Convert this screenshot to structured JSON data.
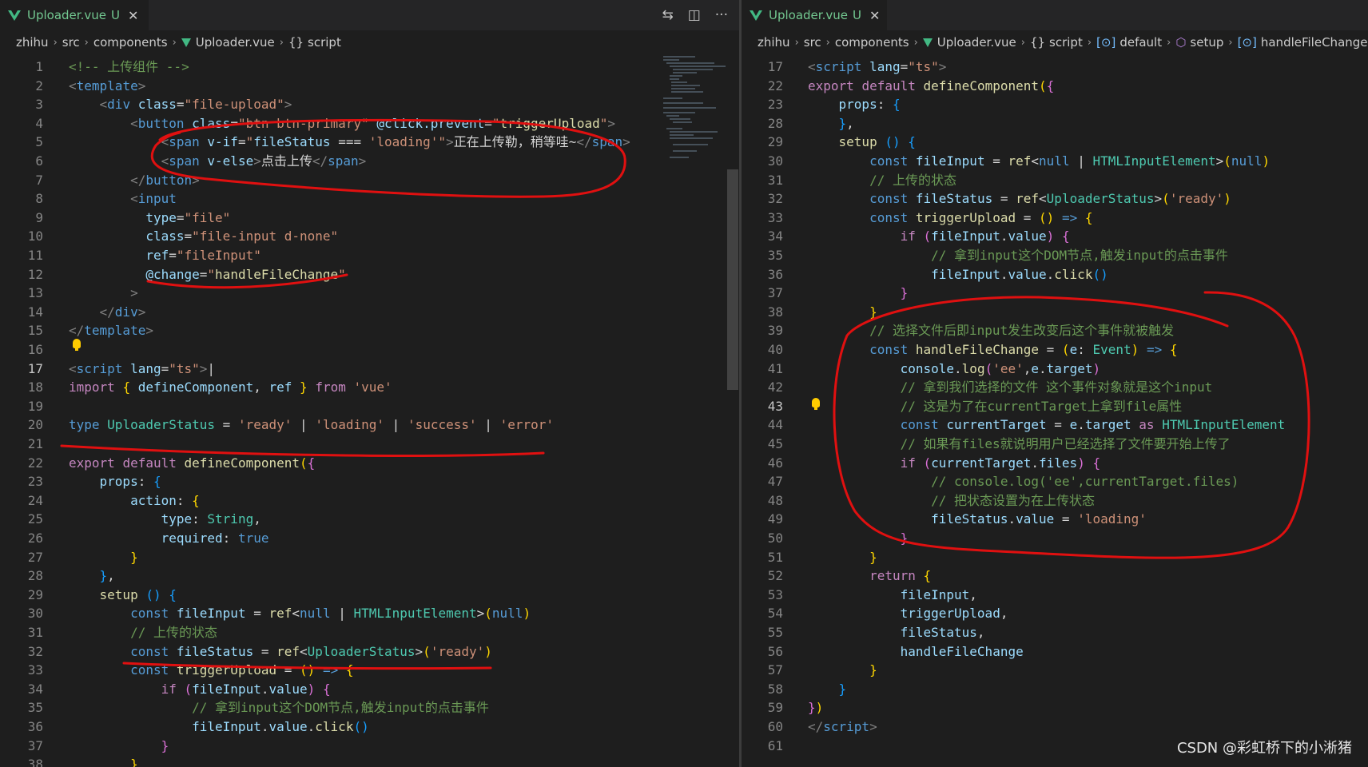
{
  "left": {
    "tab": {
      "name": "Uploader.vue",
      "modified": "U",
      "close": "✕"
    },
    "actions": [
      {
        "name": "compare-changes-icon",
        "glyph": "⇆"
      },
      {
        "name": "split-editor-icon",
        "glyph": "◫"
      },
      {
        "name": "more-actions-icon",
        "glyph": "···"
      }
    ],
    "breadcrumb": [
      {
        "label": "zhihu"
      },
      {
        "label": "src"
      },
      {
        "label": "components"
      },
      {
        "label": "Uploader.vue",
        "icon": "vue"
      },
      {
        "label": "script",
        "icon": "{}"
      }
    ],
    "lines": [
      {
        "n": "1",
        "html": "<span class='c'>&lt;!-- 上传组件 --&gt;</span>"
      },
      {
        "n": "2",
        "html": "<span class='t'>&lt;</span><span class='n'>template</span><span class='t'>&gt;</span>"
      },
      {
        "n": "3",
        "html": "    <span class='t'>&lt;</span><span class='n'>div</span> <span class='a'>class</span><span class='p'>=</span><span class='s'>\"file-upload\"</span><span class='t'>&gt;</span>"
      },
      {
        "n": "4",
        "html": "        <span class='t'>&lt;</span><span class='n'>button</span> <span class='a'>class</span><span class='p'>=</span><span class='s'>\"btn btn-primary\"</span> <span class='a'>@click.prevent</span><span class='p'>=</span><span class='s'>\"</span><span class='f'>triggerUpload</span><span class='s'>\"</span><span class='t'>&gt;</span>"
      },
      {
        "n": "5",
        "html": "            <span class='t'>&lt;</span><span class='n'>span</span> <span class='a'>v-if</span><span class='p'>=</span><span class='s'>\"</span><span class='a'>fileStatus</span> <span class='p'>===</span> <span class='s'>'loading'\"</span><span class='t'>&gt;</span><span class='p'>正在上传勒，稍等哇~</span><span class='t'>&lt;/</span><span class='n'>span</span><span class='t'>&gt;</span>"
      },
      {
        "n": "6",
        "html": "            <span class='t'>&lt;</span><span class='n'>span</span> <span class='a'>v-else</span><span class='t'>&gt;</span><span class='p'>点击上传</span><span class='t'>&lt;/</span><span class='n'>span</span><span class='t'>&gt;</span>"
      },
      {
        "n": "7",
        "html": "        <span class='t'>&lt;/</span><span class='n'>button</span><span class='t'>&gt;</span>"
      },
      {
        "n": "8",
        "html": "        <span class='t'>&lt;</span><span class='n'>input</span>"
      },
      {
        "n": "9",
        "html": "          <span class='a'>type</span><span class='p'>=</span><span class='s'>\"file\"</span>"
      },
      {
        "n": "10",
        "html": "          <span class='a'>class</span><span class='p'>=</span><span class='s'>\"file-input d-none\"</span>"
      },
      {
        "n": "11",
        "html": "          <span class='a'>ref</span><span class='p'>=</span><span class='s'>\"fileInput\"</span>"
      },
      {
        "n": "12",
        "html": "          <span class='a'>@change</span><span class='p'>=</span><span class='s'>\"</span><span class='f'>handleFileChange</span><span class='s'>\"</span>"
      },
      {
        "n": "13",
        "html": "        <span class='t'>&gt;</span>"
      },
      {
        "n": "14",
        "html": "    <span class='t'>&lt;/</span><span class='n'>div</span><span class='t'>&gt;</span>"
      },
      {
        "n": "15",
        "html": "<span class='t'>&lt;/</span><span class='n'>template</span><span class='t'>&gt;</span>"
      },
      {
        "n": "16",
        "html": ""
      },
      {
        "n": "17",
        "html": "<span class='t'>&lt;</span><span class='n'>script</span> <span class='a'>lang</span><span class='p'>=</span><span class='s'>\"ts\"</span><span class='t'>&gt;</span><span class='p'>|</span>",
        "active": true
      },
      {
        "n": "18",
        "html": "<span class='k'>import</span> <span class='b1'>{</span> <span class='a'>defineComponent</span><span class='p'>,</span> <span class='a'>ref</span> <span class='b1'>}</span> <span class='k'>from</span> <span class='s'>'vue'</span>"
      },
      {
        "n": "19",
        "html": ""
      },
      {
        "n": "20",
        "html": "<span class='n'>type</span> <span class='ty'>UploaderStatus</span> <span class='p'>=</span> <span class='s'>'ready'</span> <span class='p'>|</span> <span class='s'>'loading'</span> <span class='p'>|</span> <span class='s'>'success'</span> <span class='p'>|</span> <span class='s'>'error'</span>"
      },
      {
        "n": "21",
        "html": ""
      },
      {
        "n": "22",
        "html": "<span class='k'>export</span> <span class='k'>default</span> <span class='f'>defineComponent</span><span class='b1'>(</span><span class='b2'>{</span>"
      },
      {
        "n": "23",
        "html": "    <span class='a'>props</span><span class='p'>:</span> <span class='b3'>{</span>"
      },
      {
        "n": "24",
        "html": "        <span class='a'>action</span><span class='p'>:</span> <span class='b1'>{</span>"
      },
      {
        "n": "25",
        "html": "            <span class='a'>type</span><span class='p'>:</span> <span class='ty'>String</span><span class='p'>,</span>"
      },
      {
        "n": "26",
        "html": "            <span class='a'>required</span><span class='p'>:</span> <span class='n'>true</span>"
      },
      {
        "n": "27",
        "html": "        <span class='b1'>}</span>"
      },
      {
        "n": "28",
        "html": "    <span class='b3'>}</span><span class='p'>,</span>"
      },
      {
        "n": "29",
        "html": "    <span class='f'>setup</span> <span class='b3'>()</span> <span class='b3'>{</span>"
      },
      {
        "n": "30",
        "html": "        <span class='n'>const</span> <span class='a'>fileInput</span> <span class='p'>=</span> <span class='f'>ref</span><span class='p'>&lt;</span><span class='n'>null</span> <span class='p'>|</span> <span class='ty'>HTMLInputElement</span><span class='p'>&gt;</span><span class='b1'>(</span><span class='n'>null</span><span class='b1'>)</span>"
      },
      {
        "n": "31",
        "html": "        <span class='c'>// 上传的状态</span>"
      },
      {
        "n": "32",
        "html": "        <span class='n'>const</span> <span class='a'>fileStatus</span> <span class='p'>=</span> <span class='f'>ref</span><span class='p'>&lt;</span><span class='ty'>UploaderStatus</span><span class='p'>&gt;</span><span class='b1'>(</span><span class='s'>'ready'</span><span class='b1'>)</span>"
      },
      {
        "n": "33",
        "html": "        <span class='n'>const</span> <span class='f'>triggerUpload</span> <span class='p'>=</span> <span class='b1'>()</span> <span class='n'>=&gt;</span> <span class='b1'>{</span>"
      },
      {
        "n": "34",
        "html": "            <span class='k'>if</span> <span class='b2'>(</span><span class='a'>fileInput</span><span class='p'>.</span><span class='a'>value</span><span class='b2'>)</span> <span class='b2'>{</span>"
      },
      {
        "n": "35",
        "html": "                <span class='c'>// 拿到input这个DOM节点,触发input的点击事件</span>"
      },
      {
        "n": "36",
        "html": "                <span class='a'>fileInput</span><span class='p'>.</span><span class='a'>value</span><span class='p'>.</span><span class='f'>click</span><span class='b3'>()</span>"
      },
      {
        "n": "37",
        "html": "            <span class='b2'>}</span>"
      },
      {
        "n": "38",
        "html": "        <span class='b1'>}</span>"
      }
    ]
  },
  "right": {
    "tab": {
      "name": "Uploader.vue",
      "modified": "U",
      "close": "✕"
    },
    "breadcrumb": [
      {
        "label": "zhihu"
      },
      {
        "label": "src"
      },
      {
        "label": "components"
      },
      {
        "label": "Uploader.vue",
        "icon": "vue"
      },
      {
        "label": "script",
        "icon": "{}"
      },
      {
        "label": "default",
        "icon": "[⊙]"
      },
      {
        "label": "setup",
        "icon": "⬡"
      },
      {
        "label": "handleFileChange",
        "icon": "[⊙]"
      }
    ],
    "lines": [
      {
        "n": "17",
        "html": "<span class='t'>&lt;</span><span class='n'>script</span> <span class='a'>lang</span><span class='p'>=</span><span class='s'>\"ts\"</span><span class='t'>&gt;</span>"
      },
      {
        "n": "22",
        "html": "<span class='k'>export</span> <span class='k'>default</span> <span class='f'>defineComponent</span><span class='b1'>(</span><span class='b2'>{</span>"
      },
      {
        "n": "23",
        "html": "    <span class='a'>props</span><span class='p'>:</span> <span class='b3'>{</span>"
      },
      {
        "n": "28",
        "html": "    <span class='b3'>}</span><span class='p'>,</span>"
      },
      {
        "n": "29",
        "html": "    <span class='f'>setup</span> <span class='b3'>()</span> <span class='b3'>{</span>"
      },
      {
        "n": "30",
        "html": "        <span class='n'>const</span> <span class='a'>fileInput</span> <span class='p'>=</span> <span class='f'>ref</span><span class='p'>&lt;</span><span class='n'>null</span> <span class='p'>|</span> <span class='ty'>HTMLInputElement</span><span class='p'>&gt;</span><span class='b1'>(</span><span class='n'>null</span><span class='b1'>)</span>"
      },
      {
        "n": "31",
        "html": "        <span class='c'>// 上传的状态</span>"
      },
      {
        "n": "32",
        "html": "        <span class='n'>const</span> <span class='a'>fileStatus</span> <span class='p'>=</span> <span class='f'>ref</span><span class='p'>&lt;</span><span class='ty'>UploaderStatus</span><span class='p'>&gt;</span><span class='b1'>(</span><span class='s'>'ready'</span><span class='b1'>)</span>"
      },
      {
        "n": "33",
        "html": "        <span class='n'>const</span> <span class='f'>triggerUpload</span> <span class='p'>=</span> <span class='b1'>()</span> <span class='n'>=&gt;</span> <span class='b1'>{</span>"
      },
      {
        "n": "34",
        "html": "            <span class='k'>if</span> <span class='b2'>(</span><span class='a'>fileInput</span><span class='p'>.</span><span class='a'>value</span><span class='b2'>)</span> <span class='b2'>{</span>"
      },
      {
        "n": "35",
        "html": "                <span class='c'>// 拿到input这个DOM节点,触发input的点击事件</span>"
      },
      {
        "n": "36",
        "html": "                <span class='a'>fileInput</span><span class='p'>.</span><span class='a'>value</span><span class='p'>.</span><span class='f'>click</span><span class='b3'>()</span>"
      },
      {
        "n": "37",
        "html": "            <span class='b2'>}</span>"
      },
      {
        "n": "38",
        "html": "        <span class='b1'>}</span>"
      },
      {
        "n": "39",
        "html": "        <span class='c'>// 选择文件后即input发生改变后这个事件就被触发</span>"
      },
      {
        "n": "40",
        "html": "        <span class='n'>const</span> <span class='f'>handleFileChange</span> <span class='p'>=</span> <span class='b1'>(</span><span class='a'>e</span><span class='p'>:</span> <span class='ty'>Event</span><span class='b1'>)</span> <span class='n'>=&gt;</span> <span class='b1'>{</span>"
      },
      {
        "n": "41",
        "html": "            <span class='a'>console</span><span class='p'>.</span><span class='f'>log</span><span class='b2'>(</span><span class='s'>'ee'</span><span class='p'>,</span><span class='a'>e</span><span class='p'>.</span><span class='a'>target</span><span class='b2'>)</span>"
      },
      {
        "n": "42",
        "html": "            <span class='c'>// 拿到我们选择的文件 这个事件对象就是这个input</span>"
      },
      {
        "n": "43",
        "html": "            <span class='c'>// 这是为了在currentTarget上拿到file属性</span>",
        "active": true
      },
      {
        "n": "44",
        "html": "            <span class='n'>const</span> <span class='a'>currentTarget</span> <span class='p'>=</span> <span class='a'>e</span><span class='p'>.</span><span class='a'>target</span> <span class='k'>as</span> <span class='ty'>HTMLInputElement</span>"
      },
      {
        "n": "45",
        "html": "            <span class='c'>// 如果有files就说明用户已经选择了文件要开始上传了</span>"
      },
      {
        "n": "46",
        "html": "            <span class='k'>if</span> <span class='b2'>(</span><span class='a'>currentTarget</span><span class='p'>.</span><span class='a'>files</span><span class='b2'>)</span> <span class='b2'>{</span>"
      },
      {
        "n": "47",
        "html": "                <span class='c'>// console.log('ee',currentTarget.files)</span>"
      },
      {
        "n": "48",
        "html": "                <span class='c'>// 把状态设置为在上传状态</span>"
      },
      {
        "n": "49",
        "html": "                <span class='a'>fileStatus</span><span class='p'>.</span><span class='a'>value</span> <span class='p'>=</span> <span class='s'>'loading'</span>"
      },
      {
        "n": "50",
        "html": "            <span class='b2'>}</span>"
      },
      {
        "n": "51",
        "html": "        <span class='b1'>}</span>"
      },
      {
        "n": "52",
        "html": "        <span class='k'>return</span> <span class='b1'>{</span>"
      },
      {
        "n": "53",
        "html": "            <span class='a'>fileInput</span><span class='p'>,</span>"
      },
      {
        "n": "54",
        "html": "            <span class='a'>triggerUpload</span><span class='p'>,</span>"
      },
      {
        "n": "55",
        "html": "            <span class='a'>fileStatus</span><span class='p'>,</span>"
      },
      {
        "n": "56",
        "html": "            <span class='a'>handleFileChange</span>"
      },
      {
        "n": "57",
        "html": "        <span class='b1'>}</span>"
      },
      {
        "n": "58",
        "html": "    <span class='b3'>}</span>"
      },
      {
        "n": "59",
        "html": "<span class='b2'>}</span><span class='b1'>)</span>"
      },
      {
        "n": "60",
        "html": "<span class='t'>&lt;/</span><span class='n'>script</span><span class='t'>&gt;</span>"
      },
      {
        "n": "61",
        "html": ""
      }
    ]
  },
  "watermark": "CSDN @彩虹桥下的小淅猪",
  "annotation_color": "#e01010"
}
